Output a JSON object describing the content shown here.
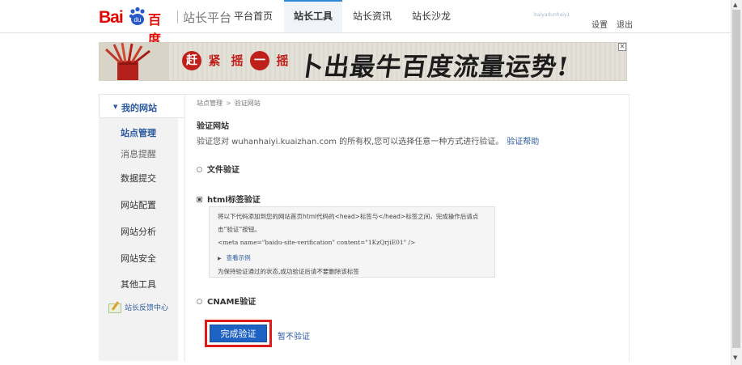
{
  "header": {
    "logo": {
      "bai": "Bai",
      "du": "du",
      "baidu_cn": "百度",
      "platform": "站长平台"
    },
    "tabs": [
      {
        "label": "平台首页",
        "active": false
      },
      {
        "label": "站长工具",
        "active": true
      },
      {
        "label": "站长资讯",
        "active": false
      },
      {
        "label": "站长沙龙",
        "active": false
      }
    ],
    "user": "baiyadunhaiy1",
    "settings": "设置",
    "logout": "退出"
  },
  "banner": {
    "cells": [
      "赶",
      "紧",
      "摇",
      "一",
      "摇"
    ],
    "slogan": "卜出最牛百度流量运势!",
    "close": "✕"
  },
  "sidebar": {
    "section": "我的网站",
    "sub_items": [
      {
        "label": "站点管理",
        "active": true
      },
      {
        "label": "消息提醒",
        "active": false
      }
    ],
    "items": [
      "数据提交",
      "网站配置",
      "网站分析",
      "网站安全",
      "其他工具"
    ],
    "feedback": "站长反馈中心"
  },
  "main": {
    "breadcrumb": [
      "站点管理",
      "验证网站"
    ],
    "title": "验证网站",
    "description": "验证您对 wuhanhaiyi.kuaizhan.com 的所有权,您可以选择任意一种方式进行验证。",
    "help_link": "验证帮助",
    "options": [
      {
        "label": "文件验证",
        "selected": false
      },
      {
        "label": "html标签验证",
        "selected": true
      },
      {
        "label": "CNAME验证",
        "selected": false
      }
    ],
    "html_box": {
      "line1": "将以下代码添加到您的网站首页html代码的<head>标签与</head>标签之间，完成操作后请点",
      "line2": "击“验证”按钮。",
      "code": "<meta name=\"baidu-site-verification\" content=\"1KzQrjiE01\" />",
      "example": "查看示例",
      "note": "为保持验证通过的状态,成功验证后请不要删除该标签"
    },
    "finish_button": "完成验证",
    "skip_link": "暂不验证"
  },
  "colors": {
    "accent_blue": "#1e63c4",
    "highlight_red": "#e01b1b",
    "brand_red": "#e10601"
  }
}
